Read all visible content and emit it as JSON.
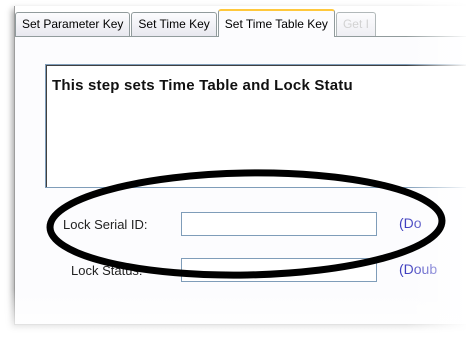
{
  "tabs": [
    {
      "label": "Set Parameter Key"
    },
    {
      "label": "Set Time Key"
    },
    {
      "label": "Set Time Table Key"
    },
    {
      "label": "Get I"
    }
  ],
  "active_tab_index": 2,
  "message": {
    "text": "This step sets Time Table and Lock Statu"
  },
  "fields": {
    "lock_serial_id": {
      "label": "Lock Serial ID:",
      "value": "",
      "hint": "(Do"
    },
    "lock_status": {
      "label": "Lock Status:",
      "value": "",
      "hint": "(Doub"
    }
  },
  "annotation": {
    "color": "#000000",
    "shape": "ellipse"
  }
}
